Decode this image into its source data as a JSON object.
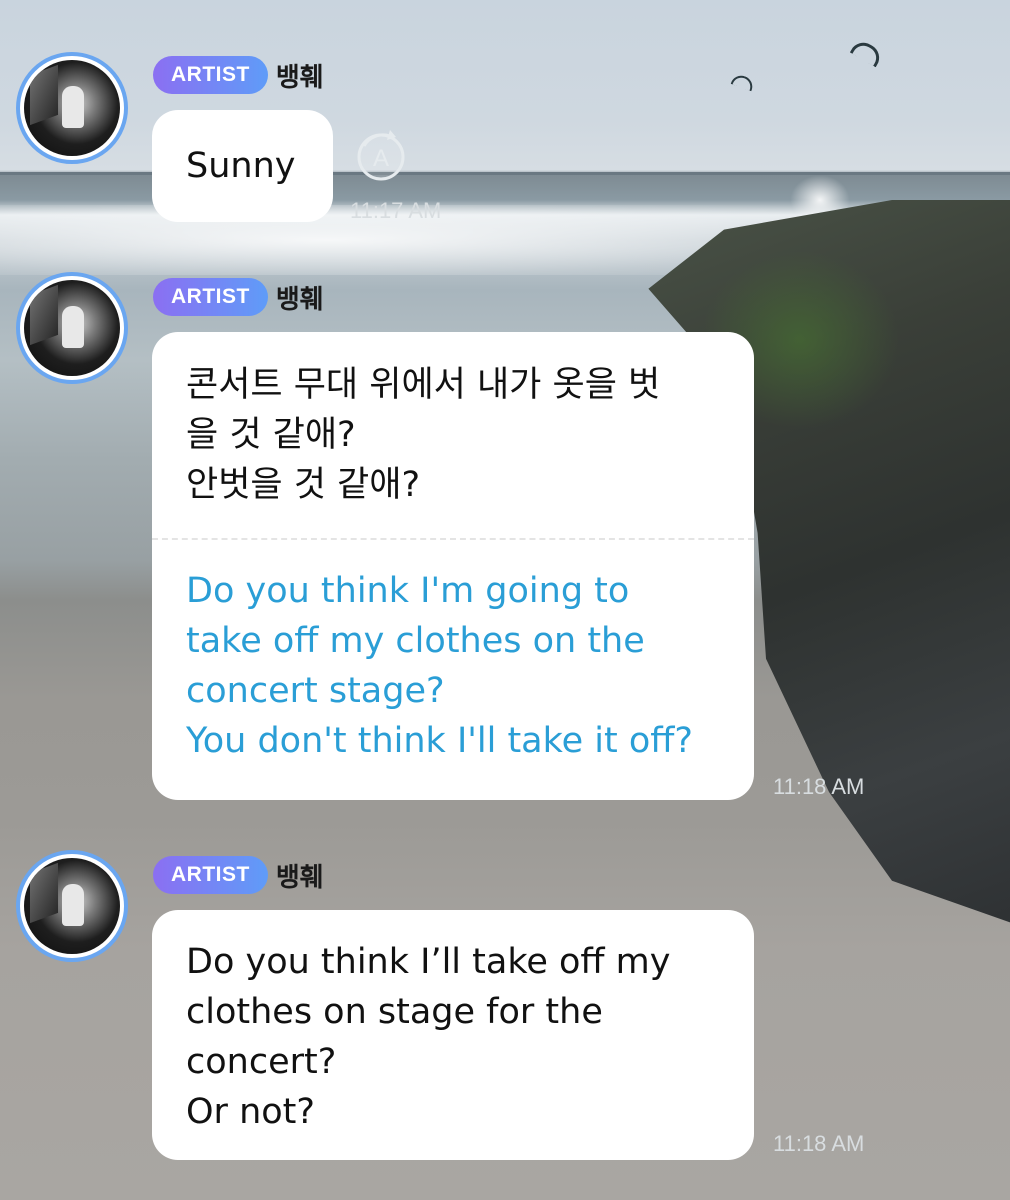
{
  "messages": [
    {
      "badge": "ARTIST",
      "sender": "뱅훼",
      "lines": [
        "Sunny"
      ],
      "translation": [],
      "time": "11:17 AM"
    },
    {
      "badge": "ARTIST",
      "sender": "뱅훼",
      "lines": [
        "콘서트 무대 위에서 내가 옷을 벗",
        "을 것 같애?",
        "안벗을 것 같애?"
      ],
      "translation": [
        "Do you think I'm going to",
        "take off my clothes on the",
        "concert stage?",
        "You don't think I'll take it off?"
      ],
      "time": "11:18 AM"
    },
    {
      "badge": "ARTIST",
      "sender": "뱅훼",
      "lines": [
        "Do you think I’ll take off my",
        "clothes on stage for the",
        "concert?",
        "Or not?"
      ],
      "translation": [],
      "time": "11:18 AM"
    }
  ],
  "icons": {
    "translate": "translate-icon",
    "avatar": "artist-avatar"
  },
  "colors": {
    "badge_start": "#8b6ff2",
    "badge_end": "#5f9cf8",
    "translation_text": "#2a9ed6",
    "avatar_ring": "#6aa6f0"
  }
}
